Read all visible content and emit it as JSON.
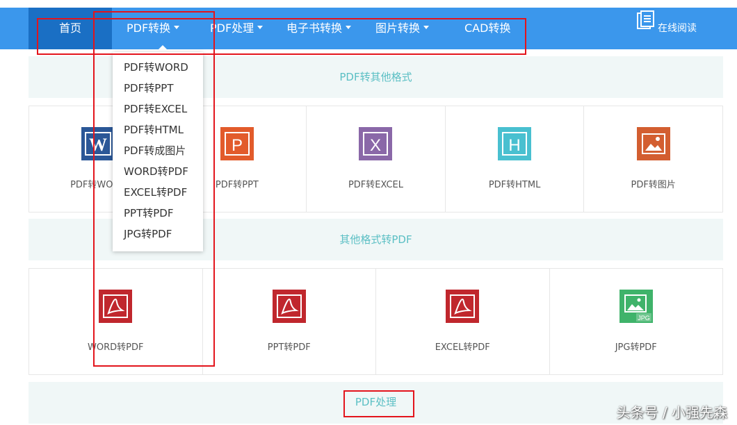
{
  "nav": {
    "home": "首页",
    "pdf_convert": "PDF转换",
    "pdf_process": "PDF处理",
    "ebook_convert": "电子书转换",
    "image_convert": "图片转换",
    "cad_convert": "CAD转换",
    "online_read": "在线阅读"
  },
  "dropdown": {
    "items": [
      "PDF转WORD",
      "PDF转PPT",
      "PDF转EXCEL",
      "PDF转HTML",
      "PDF转成图片",
      "WORD转PDF",
      "EXCEL转PDF",
      "PPT转PDF",
      "JPG转PDF"
    ]
  },
  "sections": {
    "pdf_to_other": "PDF转其他格式",
    "other_to_pdf": "其他格式转PDF",
    "pdf_process": "PDF处理"
  },
  "row1": [
    "PDF转WORD",
    "PDF转PPT",
    "PDF转EXCEL",
    "PDF转HTML",
    "PDF转图片"
  ],
  "row2": [
    "WORD转PDF",
    "PPT转PDF",
    "EXCEL转PDF",
    "JPG转PDF"
  ],
  "icons": {
    "word_letter": "W",
    "ppt_letter": "P",
    "excel_letter": "X",
    "html_letter": "H",
    "jpg_tag": "JPG"
  },
  "colors": {
    "nav_bg": "#3b97ec",
    "nav_active": "#1a6fc4",
    "section_text": "#5bbfc4",
    "word": "#2b5797",
    "ppt": "#e25b2b",
    "excel": "#8a68a8",
    "html": "#49c0d0",
    "image": "#d35e30",
    "pdf": "#c0272d",
    "jpg": "#3fb36a",
    "annotation": "#e3141c"
  },
  "watermark": "头条号 / 小强先森"
}
